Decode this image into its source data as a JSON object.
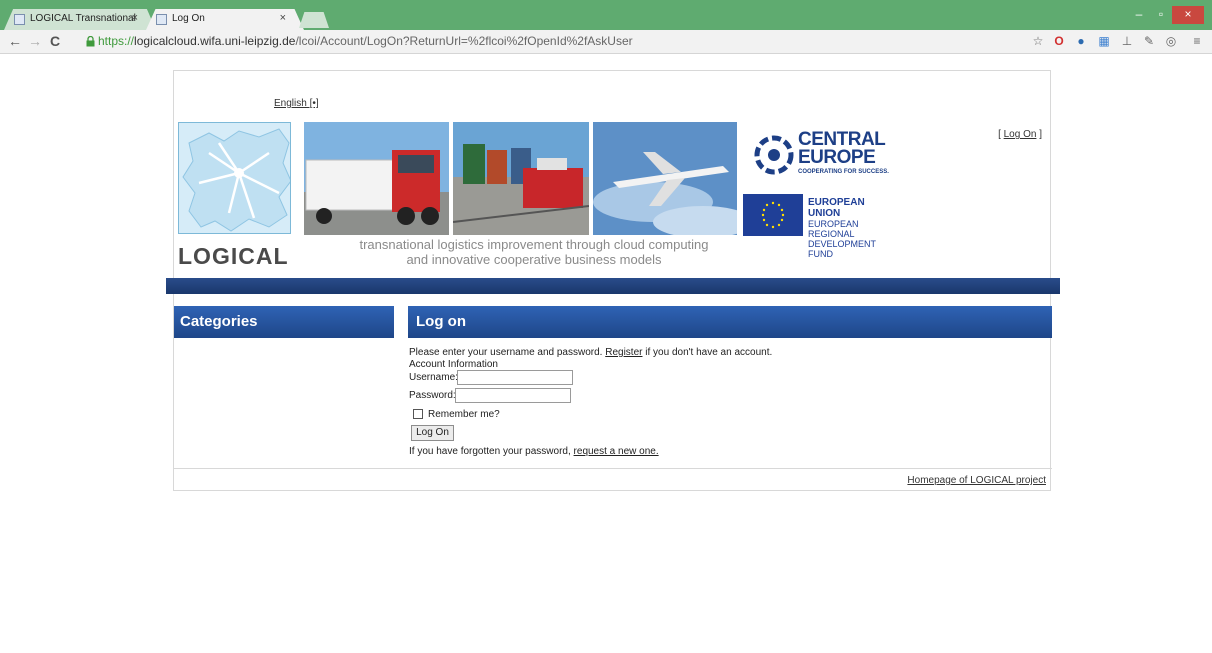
{
  "browser": {
    "tabs": [
      {
        "title": "LOGICAL Transnational Sc",
        "active": false
      },
      {
        "title": "Log On",
        "active": true
      }
    ],
    "window_buttons": {
      "minimize": "–",
      "maximize": "▫",
      "close": "×"
    },
    "url": {
      "scheme": "https://",
      "host": "logicalcloud.wifa.uni-leipzig.de",
      "path": "/lcoi/Account/LogOn?ReturnUrl=%2flcoi%2fOpenId%2fAskUser"
    }
  },
  "header": {
    "language": "English [•]",
    "login_bracket_open": "[ ",
    "login_link": "Log On",
    "login_bracket_close": " ]",
    "brand": "LOGICAL",
    "tagline_line1": "transnational logistics improvement through cloud computing",
    "tagline_line2": "and innovative cooperative business models",
    "partner_title": "CENTRAL EUROPE",
    "partner_slogan": "COOPERATING FOR SUCCESS.",
    "eu_line1": "EUROPEAN UNION",
    "eu_line2": "EUROPEAN REGIONAL",
    "eu_line3": "DEVELOPMENT FUND"
  },
  "sidebar": {
    "title": "Categories"
  },
  "main": {
    "title": "Log on",
    "intro_pre": "Please enter your username and password. ",
    "intro_link": "Register",
    "intro_post": " if you don't have an account.",
    "section_label": "Account Information",
    "username_label": "Username:",
    "username_value": "",
    "password_label": "Password:",
    "password_value": "",
    "remember_label": "Remember me?",
    "remember_checked": false,
    "submit_label": "Log On",
    "forgot_pre": "If you have forgotten your password, ",
    "forgot_link": "request a new one."
  },
  "footer": {
    "homepage_link": "Homepage of LOGICAL project"
  },
  "colors": {
    "titlebar": "#5fab70",
    "header_blue": "#1e4688",
    "partner_blue": "#1d3f86",
    "url_green": "#3f9a3c"
  }
}
